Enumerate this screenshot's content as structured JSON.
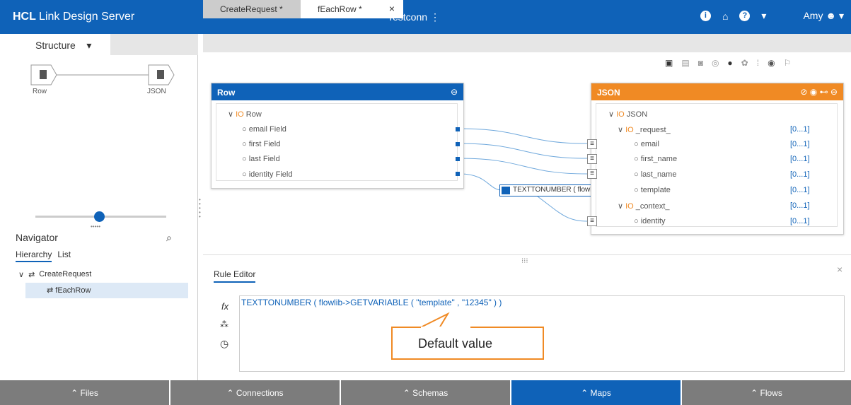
{
  "header": {
    "brand_bold": "HCL",
    "brand_rest": "Link Design Server",
    "connection": "Testconn",
    "connection_menu": "⋮",
    "user": "Amy"
  },
  "structure": {
    "tab_label": "Structure",
    "nodes": [
      "Row",
      "JSON"
    ]
  },
  "navigator": {
    "title": "Navigator",
    "tabs": [
      "Hierarchy",
      "List"
    ],
    "tree": [
      "CreateRequest",
      "fEachRow"
    ]
  },
  "editor_tabs": [
    "CreateRequest *",
    "fEachRow *"
  ],
  "row_card": {
    "title": "Row",
    "root": "Row",
    "fields": [
      "email Field",
      "first Field",
      "last Field",
      "identity Field"
    ]
  },
  "json_card": {
    "title": "JSON",
    "root": "JSON",
    "groups": [
      {
        "name": "_request_",
        "cardinality": "[0...1]",
        "children": [
          {
            "name": "email",
            "cardinality": "[0...1]"
          },
          {
            "name": "first_name",
            "cardinality": "[0...1]"
          },
          {
            "name": "last_name",
            "cardinality": "[0...1]"
          },
          {
            "name": "template",
            "cardinality": "[0...1]"
          }
        ]
      },
      {
        "name": "_context_",
        "cardinality": "[0...1]",
        "children": [
          {
            "name": "identity",
            "cardinality": "[0...1]"
          }
        ]
      }
    ]
  },
  "function_box": "TEXTTONUMBER ( flowlib",
  "rule_editor": {
    "title": "Rule Editor",
    "expression": "TEXTTONUMBER ( flowlib->GETVARIABLE ( \"template\" , \"12345\" ) )",
    "callout": "Default value"
  },
  "bottom_tabs": [
    {
      "label": "Files",
      "active": false
    },
    {
      "label": "Connections",
      "active": false
    },
    {
      "label": "Schemas",
      "active": false
    },
    {
      "label": "Maps",
      "active": true
    },
    {
      "label": "Flows",
      "active": false
    }
  ],
  "colors": {
    "primary": "#0f62b8",
    "accent": "#f08a24",
    "bottom_inactive": "#7c7c7c"
  }
}
